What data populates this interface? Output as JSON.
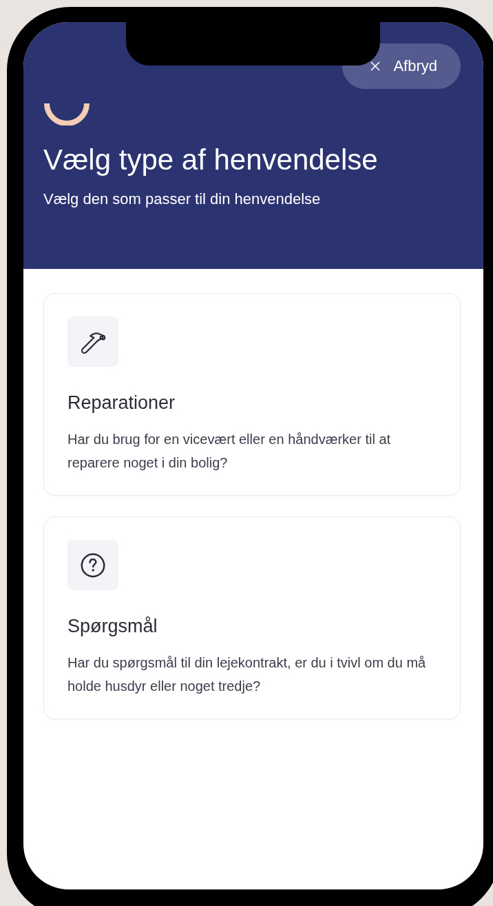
{
  "cancel_button": {
    "label": "Afbryd"
  },
  "title": "Vælg type af henvendelse",
  "subtitle": "Vælg den som passer til din henvendelse",
  "options": [
    {
      "kind": "hammer",
      "title": "Reparationer",
      "description": "Har du brug for en vicevært eller en håndværker til at reparere noget i din bolig?"
    },
    {
      "kind": "question",
      "title": "Spørgsmål",
      "description": "Har du spørgsmål til din lejekontrakt, er du i tvivl om du må holde husdyr eller noget tredje?"
    }
  ]
}
